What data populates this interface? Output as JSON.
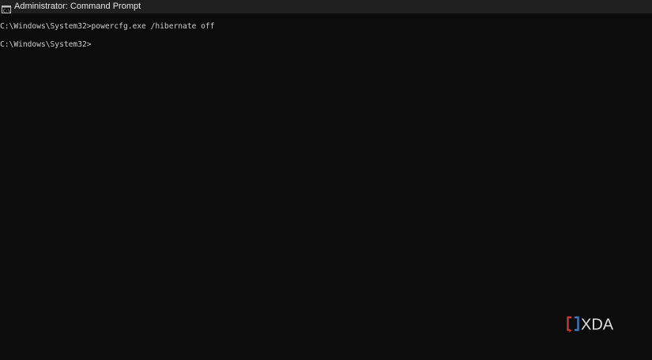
{
  "window": {
    "title": "Administrator: Command Prompt",
    "icon": "cmd-icon"
  },
  "console": {
    "lines": [
      "C:\\Windows\\System32>powercfg.exe /hibernate off",
      "",
      "C:\\Windows\\System32>"
    ]
  },
  "watermark": {
    "text": "XDA",
    "icon": "xda-logo-icon",
    "colors": {
      "bracket_red": "#d43a3a",
      "bracket_blue": "#3d7ec9",
      "text": "#e8e8e8"
    }
  }
}
